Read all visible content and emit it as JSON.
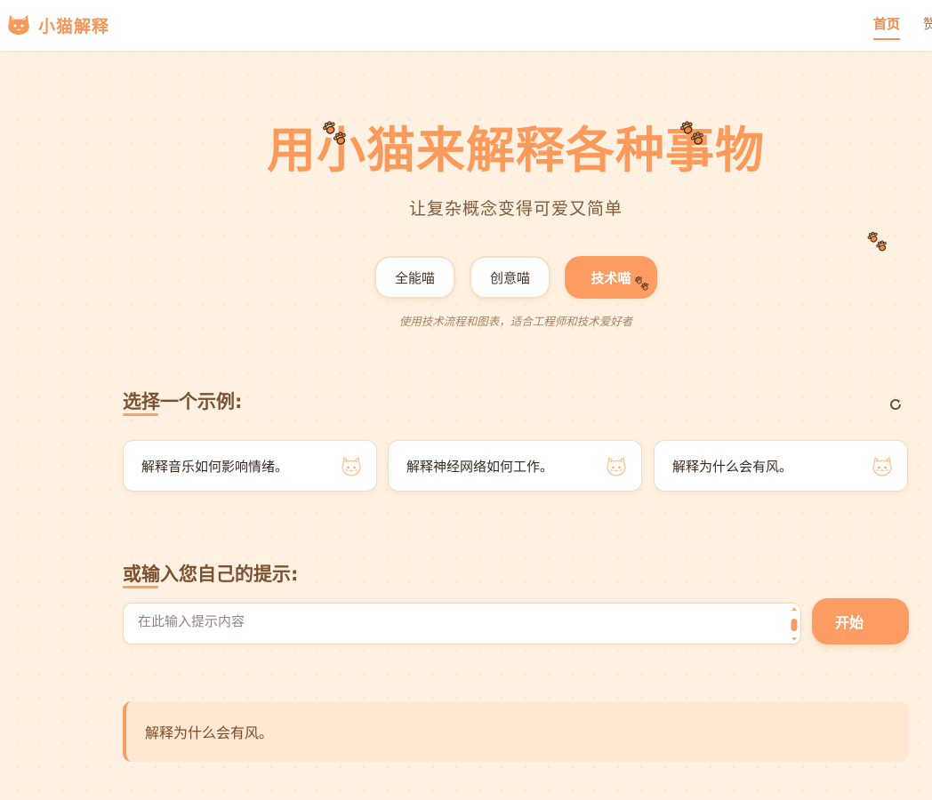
{
  "app": {
    "title": "小猫解释",
    "logo_icon": "cat-icon"
  },
  "nav": {
    "items": [
      {
        "label": "首页",
        "active": true
      },
      {
        "label": "赞"
      }
    ]
  },
  "hero": {
    "title": "用小猫来解释各种事物",
    "subtitle": "让复杂概念变得可爱又简单",
    "decoration_icon": "paw-icon"
  },
  "modes": {
    "items": [
      {
        "label": "全能喵",
        "active": false
      },
      {
        "label": "创意喵",
        "active": false
      },
      {
        "label": "技术喵",
        "active": true
      }
    ],
    "description": "使用技术流程和图表，适合工程师和技术爱好者"
  },
  "examples": {
    "title": "选择一个示例:",
    "refresh_icon": "refresh-icon",
    "items": [
      {
        "text": "解释音乐如何影响情绪。",
        "icon": "cat-face-icon"
      },
      {
        "text": "解释神经网络如何工作。",
        "icon": "cat-face-icon"
      },
      {
        "text": "解释为什么会有风。",
        "icon": "cat-face-icon"
      }
    ]
  },
  "prompt": {
    "title": "或输入您自己的提示:",
    "placeholder": "在此输入提示内容",
    "value": "",
    "submit_label": "开始"
  },
  "result": {
    "text": "解释为什么会有风。"
  },
  "colors": {
    "accent": "#fd9c63",
    "background": "#fef1e1",
    "title": "#fb9a5b",
    "section_title": "#7b5130"
  }
}
